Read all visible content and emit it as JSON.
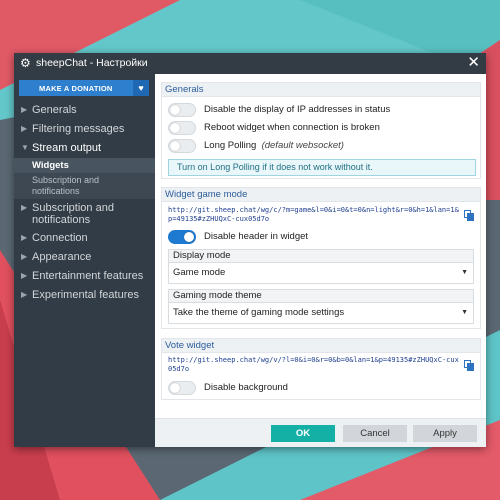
{
  "window": {
    "title": "sheepChat - Настройки",
    "app_icon": "gear-icon",
    "close_icon": "close-icon"
  },
  "sidebar": {
    "donate_label": "MAKE A DONATION",
    "donate_icon": "heart-icon",
    "items": [
      {
        "label": "Generals",
        "expanded": false
      },
      {
        "label": "Filtering messages",
        "expanded": false
      },
      {
        "label": "Stream output",
        "expanded": true
      },
      {
        "label": "Subscription and notifications",
        "expanded": false
      },
      {
        "label": "Connection",
        "expanded": false
      },
      {
        "label": "Appearance",
        "expanded": false
      },
      {
        "label": "Entertainment features",
        "expanded": false
      },
      {
        "label": "Experimental features",
        "expanded": false
      }
    ],
    "subitems": [
      {
        "label": "Widgets",
        "active": true
      },
      {
        "label": "Subscription and notifications",
        "active": false
      }
    ]
  },
  "generals": {
    "header": "Generals",
    "toggles": [
      {
        "label": "Disable the display of IP addresses in status",
        "on": false
      },
      {
        "label": "Reboot widget when connection is broken",
        "on": false
      },
      {
        "label": "Long Polling",
        "note": "(default websocket)",
        "on": false
      }
    ],
    "info": "Turn on Long Polling if it does not work without it."
  },
  "widget_game_mode": {
    "header": "Widget game mode",
    "url": "http://git.sheep.chat/wg/c/?m=game&l=0&i=0&t=0&n=light&r=0&h=1&lan=1&p=49135#zZHUQxC-cux05d7o",
    "toggle": {
      "label": "Disable header in widget",
      "on": true
    },
    "display_mode": {
      "label": "Display mode",
      "value": "Game mode"
    },
    "theme": {
      "label": "Gaming mode theme",
      "value": "Take the theme of gaming mode settings"
    }
  },
  "vote_widget": {
    "header": "Vote widget",
    "url": "http://git.sheep.chat/wg/v/?l=0&i=0&r=0&b=0&lan=1&p=49135#zZHUQxC-cux05d7o",
    "toggle": {
      "label": "Disable background",
      "on": false
    }
  },
  "footer": {
    "ok": "OK",
    "cancel": "Cancel",
    "apply": "Apply"
  },
  "colors": {
    "titlebar": "#333c44",
    "sidebar": "#323c46",
    "accent_blue": "#1e7ad0",
    "ok_button": "#14b0a6",
    "section_header_text": "#2b5d9a"
  }
}
